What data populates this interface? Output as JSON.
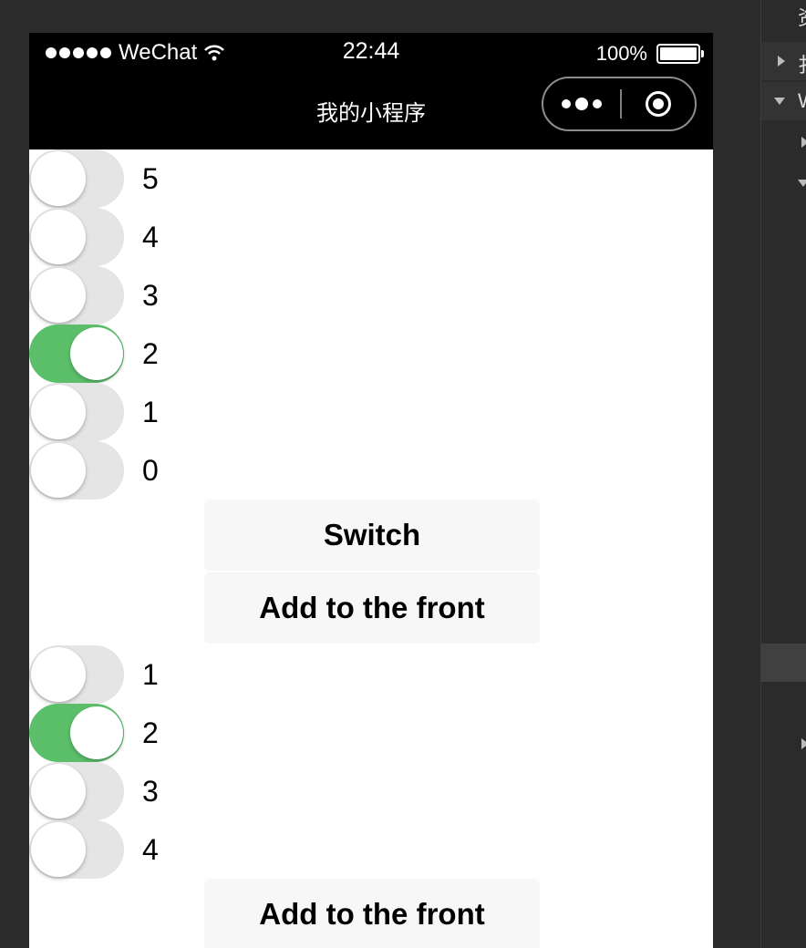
{
  "statusbar": {
    "carrier": "WeChat",
    "time": "22:44",
    "battery": "100%"
  },
  "navbar": {
    "title": "我的小程序"
  },
  "group1": {
    "switches": [
      {
        "label": "5",
        "checked": false
      },
      {
        "label": "4",
        "checked": false
      },
      {
        "label": "3",
        "checked": false
      },
      {
        "label": "2",
        "checked": true
      },
      {
        "label": "1",
        "checked": false
      },
      {
        "label": "0",
        "checked": false
      }
    ],
    "switch_button": "Switch",
    "add_front_button": "Add to the front"
  },
  "group2": {
    "switches": [
      {
        "label": "1",
        "checked": false
      },
      {
        "label": "2",
        "checked": true
      },
      {
        "label": "3",
        "checked": false
      },
      {
        "label": "4",
        "checked": false
      }
    ],
    "add_front_button": "Add to the front"
  },
  "side_panel": {
    "item1": "扌",
    "item2": "W",
    "top_char": "资"
  },
  "colors": {
    "switch_on": "#5bbf6a",
    "switch_off": "#e5e5e5",
    "button_bg": "#f7f7f7"
  }
}
